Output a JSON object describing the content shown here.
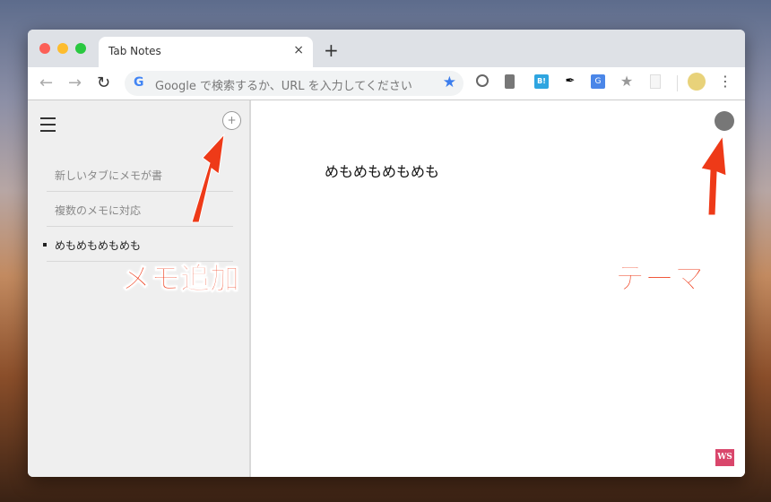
{
  "tab": {
    "title": "Tab Notes",
    "close": "×",
    "new": "+"
  },
  "toolbar": {
    "back": "←",
    "forward": "→",
    "reload": "↻",
    "google": "G",
    "omnibox_placeholder": "Google で検索するか、URL を入力してください",
    "star": "★",
    "menu": "⋮",
    "extensions": [
      "block-icon",
      "evernote-icon",
      "hatena-bookmark-icon",
      "pin-icon",
      "google-translate-icon",
      "star-extension-icon",
      "document-icon"
    ],
    "hatena_label": "B!"
  },
  "sidebar": {
    "add": "+",
    "items": [
      {
        "label": "新しいタブにメモが書"
      },
      {
        "label": "複数のメモに対応"
      },
      {
        "label": "めもめもめもめも"
      }
    ]
  },
  "main": {
    "memo_text": "めもめもめもめも",
    "badge": "WS"
  },
  "annotations": {
    "add_memo": "メモ追加",
    "theme": "テーマ"
  },
  "colors": {
    "accent": "#ee3a18",
    "theme_dot": "#777777",
    "badge": "#d9466b"
  }
}
